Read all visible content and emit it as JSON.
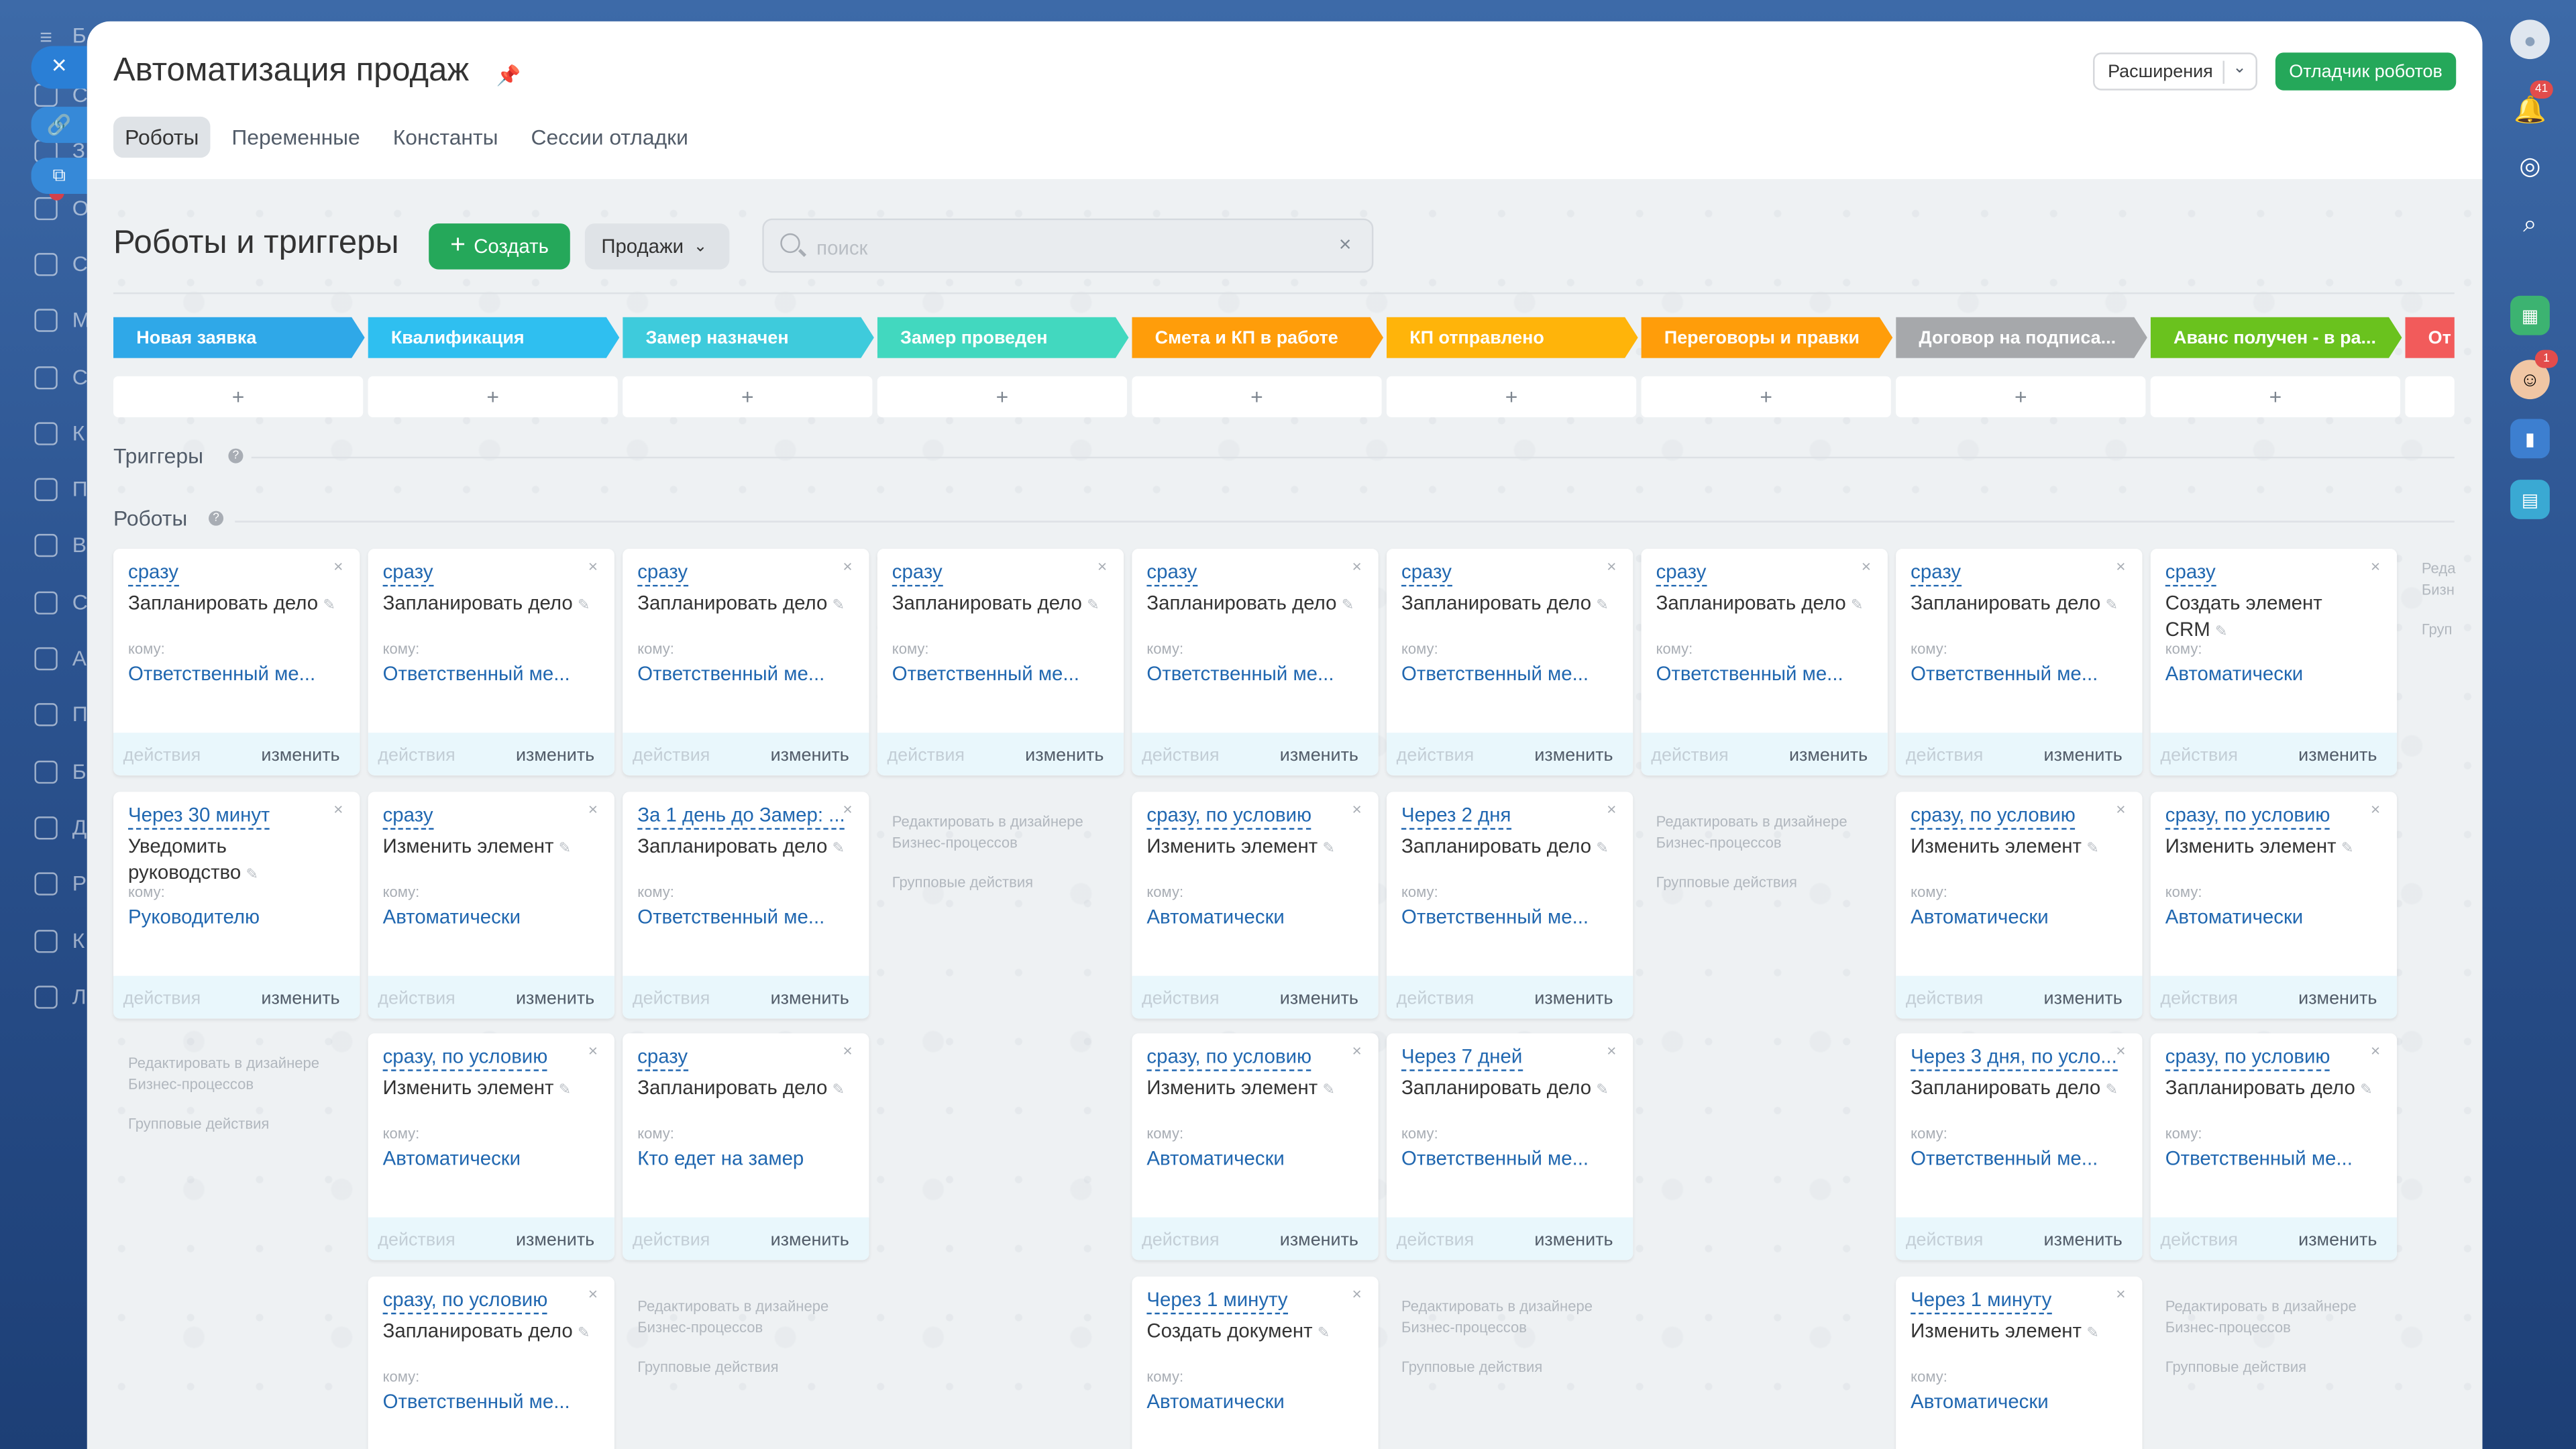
{
  "panel": {
    "title": "Автоматизация продаж",
    "tabs": [
      "Роботы",
      "Переменные",
      "Константы",
      "Сессии отладки"
    ],
    "extensions_label": "Расширения",
    "debugger_label": "Отладчик роботов"
  },
  "toolbar": {
    "section_title": "Роботы и триггеры",
    "create_label": "Создать",
    "category_label": "Продажи",
    "search_placeholder": "поиск"
  },
  "stages": [
    {
      "name": "Новая заявка",
      "color": "#2fa8e8"
    },
    {
      "name": "Квалификация",
      "color": "#2fbff0"
    },
    {
      "name": "Замер назначен",
      "color": "#3ecbdc"
    },
    {
      "name": "Замер проведен",
      "color": "#42d8bf"
    },
    {
      "name": "Смета и КП в работе",
      "color": "#ff9d0a"
    },
    {
      "name": "КП отправлено",
      "color": "#ffb40a"
    },
    {
      "name": "Переговоры и правки",
      "color": "#ff9d0a"
    },
    {
      "name": "Договор на подписа...",
      "color": "#a6a8ab"
    },
    {
      "name": "Аванс получен - в ра...",
      "color": "#6ac21e"
    },
    {
      "name": "От",
      "color": "#f25b5b"
    }
  ],
  "plus_symbol": "+",
  "triggers_label": "Триггеры",
  "robots_label": "Роботы",
  "help_symbol": "?",
  "card_common": {
    "to_label": "кому:",
    "actions_label": "действия",
    "change_label": "изменить",
    "close_symbol": "×",
    "edit_symbol": "✎"
  },
  "ghost": {
    "designer": "Редактировать в дизайнере Бизнес-процессов",
    "group": "Групповые действия"
  },
  "right_peek": {
    "line1": "Реда",
    "line2": "Бизн",
    "line3": "Груп"
  },
  "columns": [
    {
      "cards": [
        {
          "when": "сразу",
          "name": "Запланировать дело",
          "who": "Ответственный ме..."
        },
        {
          "when": "Через 30 минут",
          "name": "Уведомить руководство",
          "who": "Руководителю"
        }
      ]
    },
    {
      "cards": [
        {
          "when": "сразу",
          "name": "Запланировать дело",
          "who": "Ответственный ме..."
        },
        {
          "when": "сразу",
          "name": "Изменить элемент",
          "who": "Автоматически"
        },
        {
          "when": "сразу, по условию",
          "name": "Изменить элемент",
          "who": "Автоматически"
        },
        {
          "when": "сразу, по условию",
          "name": "Запланировать дело",
          "who": "Ответственный ме..."
        }
      ]
    },
    {
      "cards": [
        {
          "when": "сразу",
          "name": "Запланировать дело",
          "who": "Ответственный ме..."
        },
        {
          "when": "За 1 день до Замер: ...",
          "name": "Запланировать дело",
          "who": "Ответственный ме..."
        },
        {
          "when": "сразу",
          "name": "Запланировать дело",
          "who": "Кто едет на замер"
        }
      ]
    },
    {
      "cards": [
        {
          "when": "сразу",
          "name": "Запланировать дело",
          "who": "Ответственный ме..."
        }
      ]
    },
    {
      "cards": [
        {
          "when": "сразу",
          "name": "Запланировать дело",
          "who": "Ответственный ме..."
        },
        {
          "when": "сразу, по условию",
          "name": "Изменить элемент",
          "who": "Автоматически"
        },
        {
          "when": "сразу, по условию",
          "name": "Изменить элемент",
          "who": "Автоматически"
        },
        {
          "when": "Через 1 минуту",
          "name": "Создать документ",
          "who": "Автоматически"
        }
      ]
    },
    {
      "cards": [
        {
          "when": "сразу",
          "name": "Запланировать дело",
          "who": "Ответственный ме..."
        },
        {
          "when": "Через 2 дня",
          "name": "Запланировать дело",
          "who": "Ответственный ме..."
        },
        {
          "when": "Через 7 дней",
          "name": "Запланировать дело",
          "who": "Ответственный ме..."
        }
      ]
    },
    {
      "cards": [
        {
          "when": "сразу",
          "name": "Запланировать дело",
          "who": "Ответственный ме..."
        }
      ]
    },
    {
      "cards": [
        {
          "when": "сразу",
          "name": "Запланировать дело",
          "who": "Ответственный ме..."
        },
        {
          "when": "сразу, по условию",
          "name": "Изменить элемент",
          "who": "Автоматически"
        },
        {
          "when": "Через 3 дня, по усло...",
          "name": "Запланировать дело",
          "who": "Ответственный ме..."
        },
        {
          "when": "Через 1 минуту",
          "name": "Изменить элемент",
          "who": "Автоматически"
        }
      ]
    },
    {
      "cards": [
        {
          "when": "сразу",
          "name": "Создать элемент CRM",
          "who": "Автоматически"
        },
        {
          "when": "сразу, по условию",
          "name": "Изменить элемент",
          "who": "Автоматически"
        },
        {
          "when": "сразу, по условию",
          "name": "Запланировать дело",
          "who": "Ответственный ме..."
        }
      ]
    }
  ],
  "left_sidebar": {
    "logo_letter": "Б",
    "items": [
      "С",
      "З",
      "О",
      "С",
      "М",
      "С",
      "К",
      "П",
      "В",
      "С",
      "А",
      "П",
      "Б",
      "Д",
      "Р",
      "К",
      "Л"
    ],
    "badge": "1"
  },
  "right_sidebar": {
    "notify_count": "41",
    "avatar_badge": "1"
  }
}
